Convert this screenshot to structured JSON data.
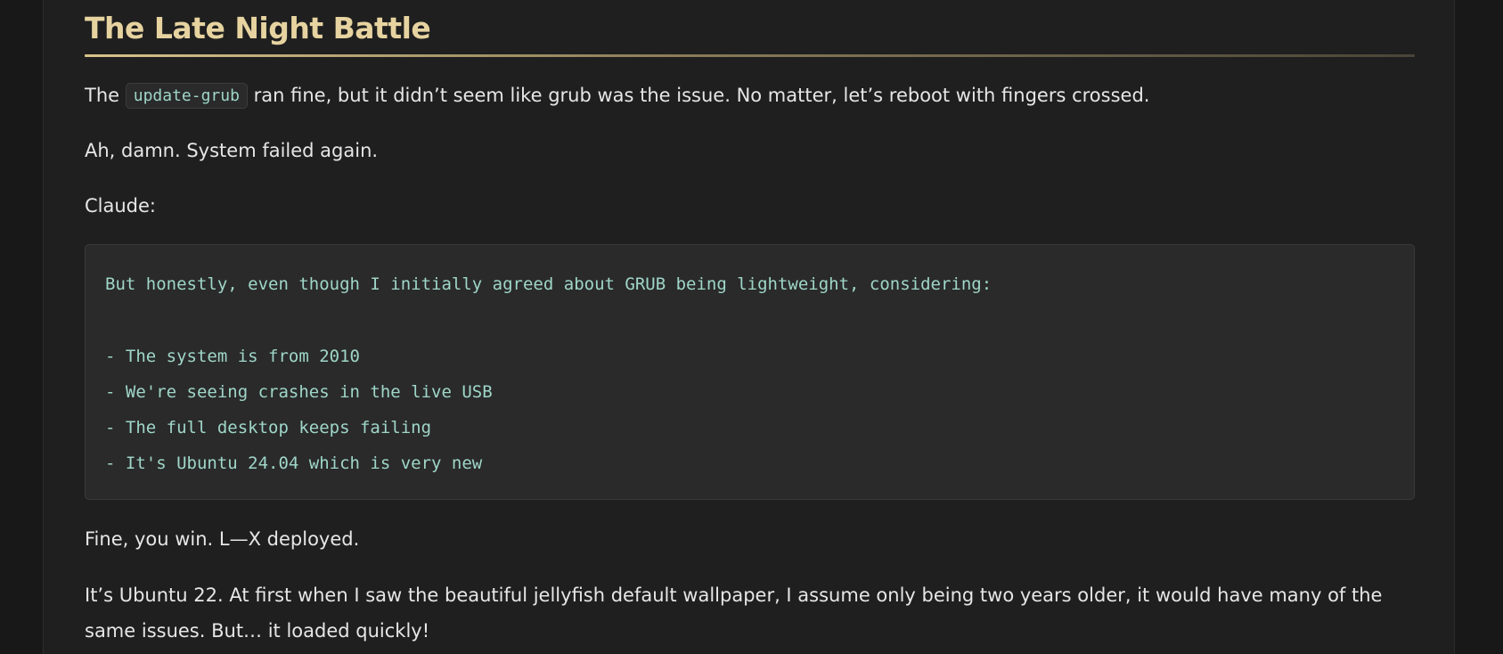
{
  "section": {
    "title": "The Late Night Battle"
  },
  "paragraph1": {
    "before": "The ",
    "code": "update-grub",
    "after": " ran fine, but it didn’t seem like grub was the issue. No matter, let’s reboot with fingers crossed."
  },
  "paragraph2": "Ah, damn. System failed again.",
  "paragraph3": "Claude:",
  "code_block": {
    "intro": "But honestly, even though I initially agreed about GRUB being lightweight, considering:",
    "items": [
      "- The system is from 2010",
      "- We're seeing crashes in the live USB",
      "- The full desktop keeps failing",
      "- It's Ubuntu 24.04 which is very new"
    ]
  },
  "paragraph4": "Fine, you win. L—X deployed.",
  "paragraph5": "It’s Ubuntu 22. At first when I saw the beautiful jellyfish default wallpaper, I assume only being two years older, it would have many of the same issues. But… it loaded quickly!",
  "colors": {
    "page_background": "#181818",
    "article_background": "#1f1f1f",
    "heading": "#e6d3a0",
    "code_text": "#9fd6c8",
    "body_text": "#e6e6e6"
  }
}
